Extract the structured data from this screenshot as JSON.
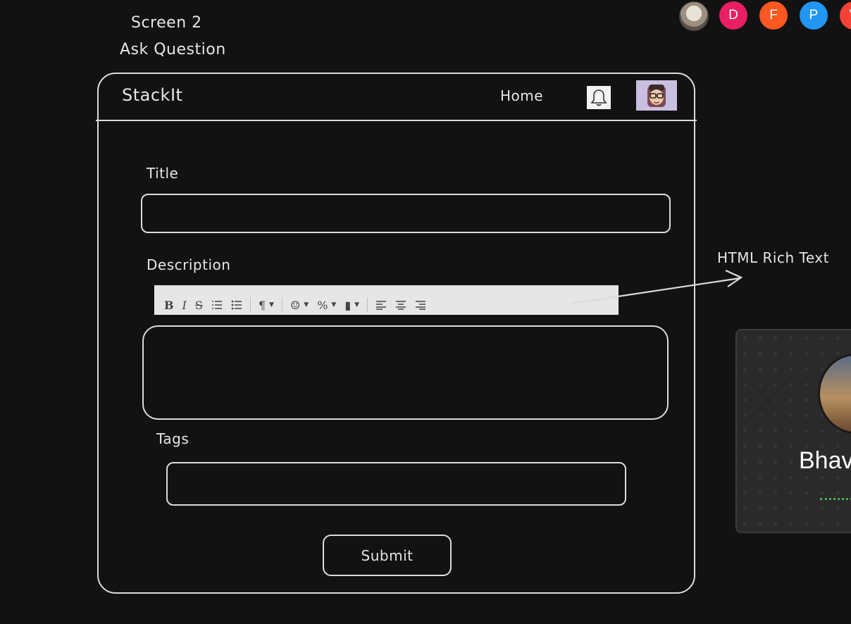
{
  "collaborators": [
    {
      "initial": "",
      "color": "#9c8f80"
    },
    {
      "initial": "D",
      "color": "#e91e63"
    },
    {
      "initial": "F",
      "color": "#ff5722"
    },
    {
      "initial": "P",
      "color": "#2196f3"
    },
    {
      "initial": "V",
      "color": "#f44336"
    }
  ],
  "screen": {
    "number_label": "Screen 2",
    "name_label": "Ask Question"
  },
  "navbar": {
    "logo": "StackIt",
    "home_link": "Home",
    "bell_icon": "bell-icon",
    "profile_icon": "avatar-icon"
  },
  "form": {
    "title_label": "Title",
    "title_value": "",
    "description_label": "Description",
    "description_value": "",
    "tags_label": "Tags",
    "tags_value": "",
    "submit_label": "Submit"
  },
  "toolbar": {
    "bold": "B",
    "italic": "I",
    "strike": "S",
    "ordered_list": "≡",
    "bullet_list": "≣",
    "paragraph": "¶",
    "emoji": "☺",
    "link": "%",
    "file": "▮",
    "align_left": "≡",
    "align_center": "≡",
    "align_right": "≡"
  },
  "annotation": {
    "text": "HTML Rich Text"
  },
  "side_card": {
    "name": "Bhav"
  }
}
